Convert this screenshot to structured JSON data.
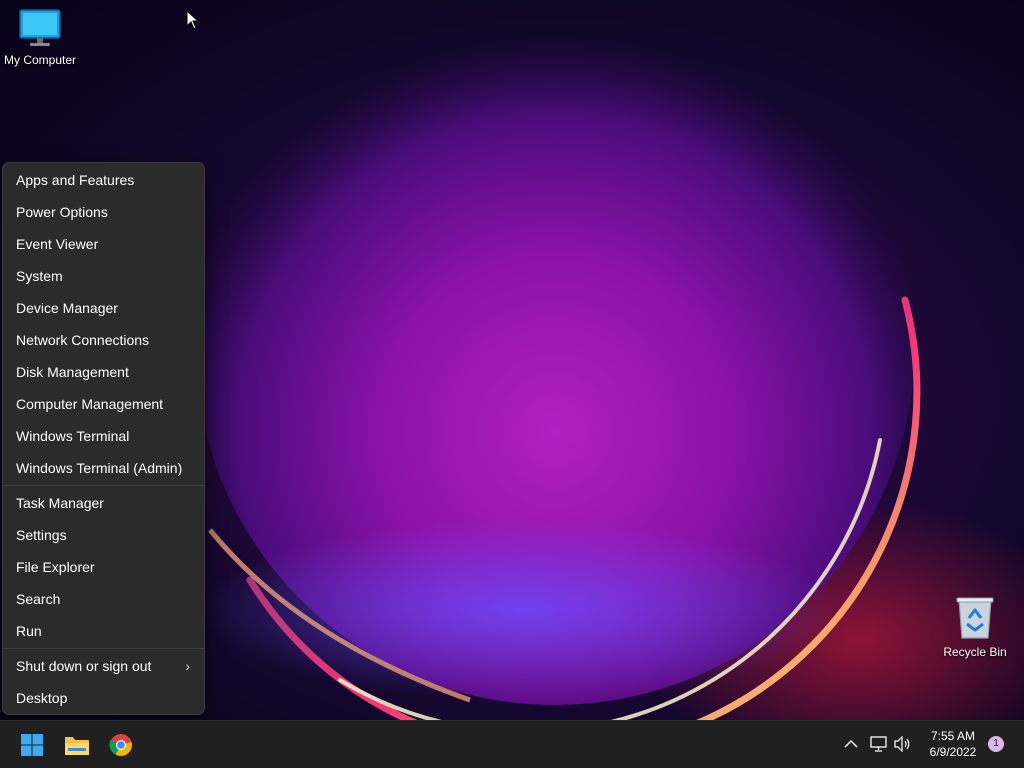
{
  "desktop": {
    "icons": [
      {
        "label": "My Computer"
      },
      {
        "label": "Recycle Bin"
      }
    ]
  },
  "context_menu": {
    "items": [
      {
        "label": "Apps and Features"
      },
      {
        "label": "Power Options"
      },
      {
        "label": "Event Viewer"
      },
      {
        "label": "System"
      },
      {
        "label": "Device Manager"
      },
      {
        "label": "Network Connections"
      },
      {
        "label": "Disk Management"
      },
      {
        "label": "Computer Management"
      },
      {
        "label": "Windows Terminal"
      },
      {
        "label": "Windows Terminal (Admin)"
      },
      {
        "label": "Task Manager"
      },
      {
        "label": "Settings"
      },
      {
        "label": "File Explorer"
      },
      {
        "label": "Search"
      },
      {
        "label": "Run"
      },
      {
        "label": "Shut down or sign out",
        "submenu": true
      },
      {
        "label": "Desktop"
      }
    ],
    "chevron": "›"
  },
  "taskbar": {
    "pinned": [
      {
        "name": "start-button",
        "icon": "windows-logo-icon"
      },
      {
        "name": "file-explorer",
        "icon": "folder-icon"
      },
      {
        "name": "chrome",
        "icon": "chrome-icon"
      }
    ],
    "tray": {
      "time": "7:55 AM",
      "date": "6/9/2022",
      "notification_count": "1"
    }
  },
  "colors": {
    "menu_bg": "#2b2b2b",
    "taskbar_bg": "#202020",
    "accent": "#0a84ff"
  }
}
